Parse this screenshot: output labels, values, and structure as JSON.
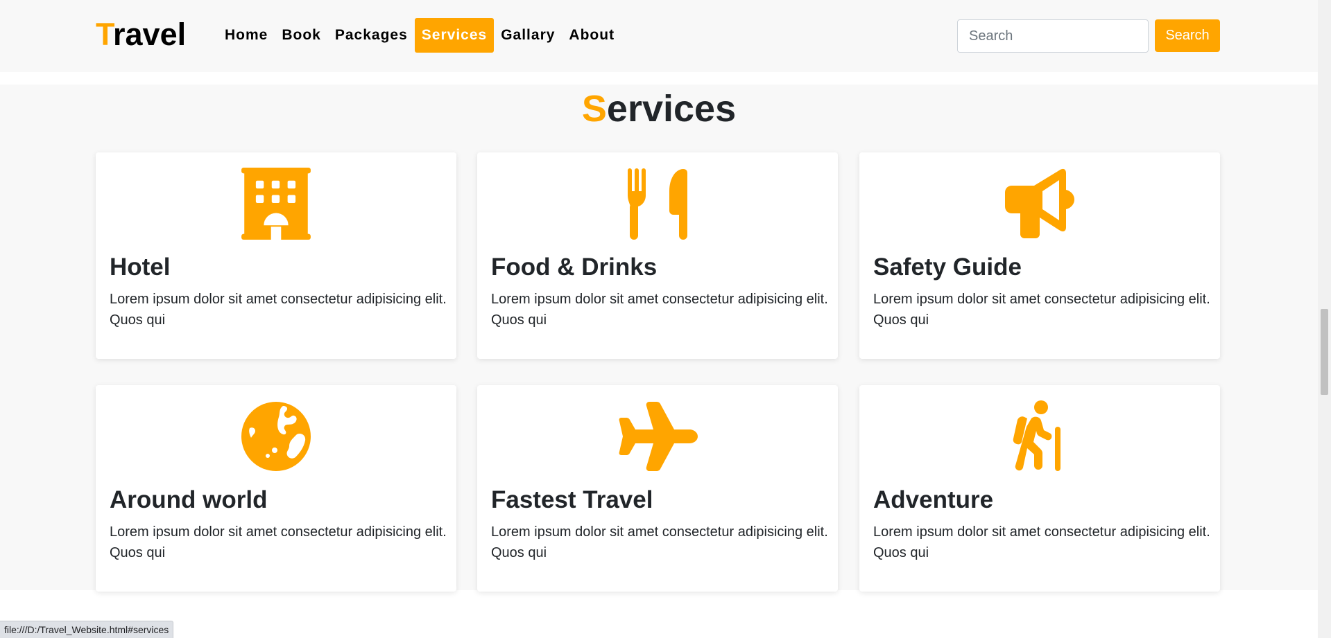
{
  "brand": {
    "logo_first": "T",
    "logo_rest": "ravel"
  },
  "nav": {
    "items": [
      {
        "label": "Home",
        "active": false
      },
      {
        "label": "Book",
        "active": false
      },
      {
        "label": "Packages",
        "active": false
      },
      {
        "label": "Services",
        "active": true
      },
      {
        "label": "Gallary",
        "active": false
      },
      {
        "label": "About",
        "active": false
      }
    ]
  },
  "search": {
    "placeholder": "Search",
    "value": "",
    "button_label": "Search"
  },
  "services": {
    "title_first": "S",
    "title_rest": "ervices",
    "cards": [
      {
        "icon": "hotel-icon",
        "title": "Hotel",
        "text": "Lorem ipsum dolor sit amet consectetur adipisicing elit. Quos qui"
      },
      {
        "icon": "utensils-icon",
        "title": "Food & Drinks",
        "text": "Lorem ipsum dolor sit amet consectetur adipisicing elit. Quos qui"
      },
      {
        "icon": "bullhorn-icon",
        "title": "Safety Guide",
        "text": "Lorem ipsum dolor sit amet consectetur adipisicing elit. Quos qui"
      },
      {
        "icon": "globe-icon",
        "title": "Around world",
        "text": "Lorem ipsum dolor sit amet consectetur adipisicing elit. Quos qui"
      },
      {
        "icon": "plane-icon",
        "title": "Fastest Travel",
        "text": "Lorem ipsum dolor sit amet consectetur adipisicing elit. Quos qui"
      },
      {
        "icon": "hiking-icon",
        "title": "Adventure",
        "text": "Lorem ipsum dolor sit amet consectetur adipisicing elit. Quos qui"
      }
    ]
  },
  "status_bar": {
    "url": "file:///D:/Travel_Website.html#services"
  },
  "colors": {
    "accent": "#ffa500",
    "background": "#f8f8f8",
    "text": "#212529"
  }
}
